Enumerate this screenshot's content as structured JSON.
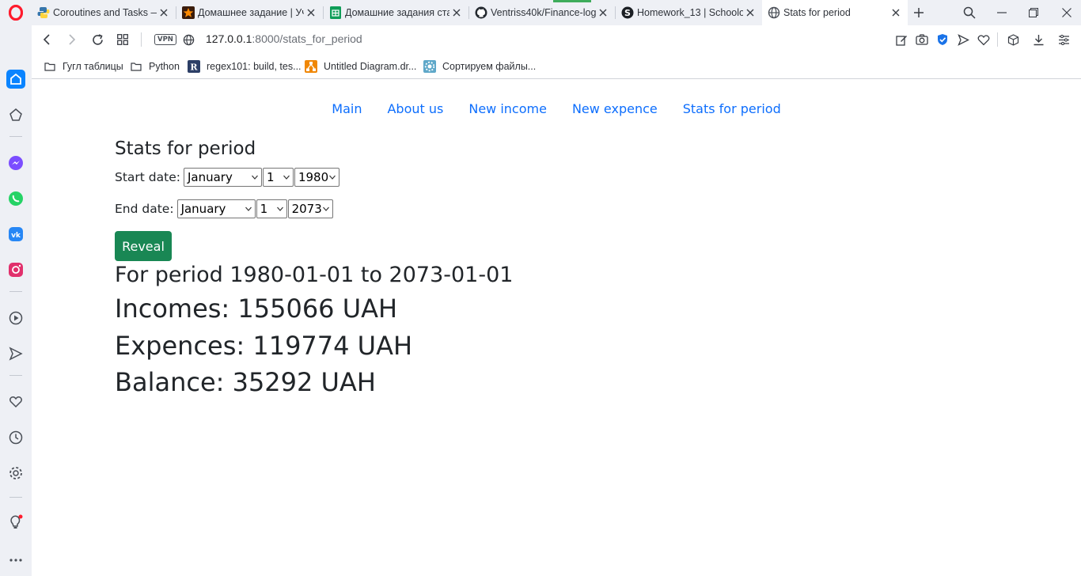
{
  "browser": {
    "tabs": [
      {
        "title": "Coroutines and Tasks —",
        "icon": "python-icon"
      },
      {
        "title": "Домашнее задание | Уч",
        "icon": "star-logo-icon"
      },
      {
        "title": "Домашние задания ста",
        "icon": "google-sheets-icon"
      },
      {
        "title": "Ventriss40k/Finance-log",
        "icon": "github-icon"
      },
      {
        "title": "Homework_13 | Schoolo",
        "icon": "skype-icon"
      },
      {
        "title": "Stats for period",
        "icon": "globe-icon",
        "active": true
      }
    ],
    "vpn_label": "VPN",
    "url_host": "127.0.0.1",
    "url_rest": ":8000/stats_for_period",
    "bookmarks": [
      {
        "label": "Гугл таблицы",
        "icon": "folder-icon"
      },
      {
        "label": "Python",
        "icon": "folder-icon"
      },
      {
        "label": "regex101: build, tes...",
        "icon": "regex101-icon"
      },
      {
        "label": "Untitled Diagram.dr...",
        "icon": "drawio-icon"
      },
      {
        "label": "Сортируем файлы...",
        "icon": "gear-site-icon"
      }
    ],
    "accent_color": "#0a84ff",
    "opera_color": "#ff1b2d"
  },
  "nav": {
    "main": "Main",
    "about": "About us",
    "new_income": "New income",
    "new_expence": "New expence",
    "stats": "Stats for period"
  },
  "form": {
    "title": "Stats for period",
    "start_label": "Start date:",
    "start_month": "January",
    "start_day": "1",
    "start_year": "1980",
    "end_label": "End date:",
    "end_month": "January",
    "end_day": "1",
    "end_year": "2073",
    "reveal_label": "Reveal"
  },
  "results": {
    "period": "For period 1980-01-01 to 2073-01-01",
    "incomes": "Incomes: 155066 UAH",
    "expences": "Expences: 119774 UAH",
    "balance": "Balance: 35292 UAH"
  },
  "colors": {
    "link": "#0d6efd",
    "button": "#198754"
  }
}
